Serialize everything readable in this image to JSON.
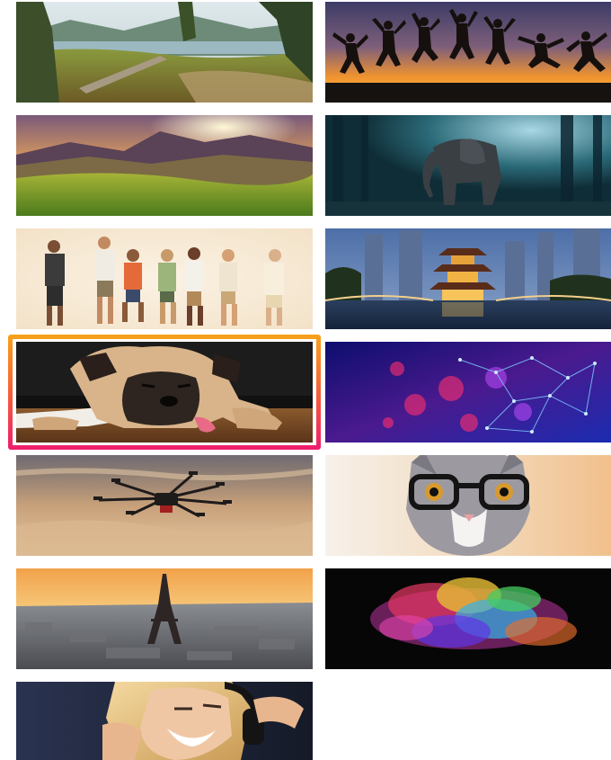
{
  "gallery": {
    "selected_tile": "pug",
    "selection_colors": [
      "#f7a21b",
      "#f45b3c",
      "#ee1d6e"
    ],
    "tiles": [
      {
        "id": "mountain-lake",
        "column": "left"
      },
      {
        "id": "jumping-silhouettes",
        "column": "right"
      },
      {
        "id": "sunset-meadow",
        "column": "left"
      },
      {
        "id": "forest-elephant",
        "column": "right"
      },
      {
        "id": "jumping-friends",
        "column": "left"
      },
      {
        "id": "pagoda-city-night",
        "column": "right"
      },
      {
        "id": "pug",
        "column": "left"
      },
      {
        "id": "network-bokeh",
        "column": "right"
      },
      {
        "id": "drone-sky",
        "column": "left"
      },
      {
        "id": "cat-glasses",
        "column": "right"
      },
      {
        "id": "paris-eiffel",
        "column": "left"
      },
      {
        "id": "color-explosion",
        "column": "right"
      },
      {
        "id": "woman-headphones",
        "column": "left"
      }
    ]
  }
}
